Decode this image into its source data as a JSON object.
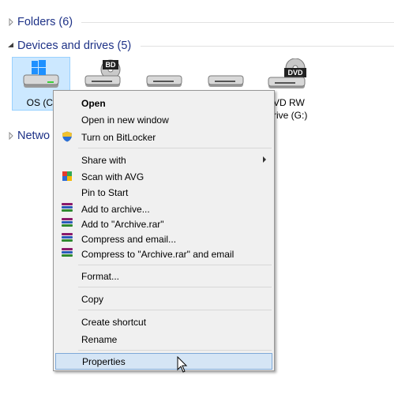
{
  "groups": {
    "folders": {
      "title": "Folders (6)"
    },
    "devices": {
      "title": "Devices and drives (5)"
    },
    "network": {
      "title": "Netwo"
    }
  },
  "drives": [
    {
      "label": "OS (C:",
      "icon": "windows-drive",
      "badge": ""
    },
    {
      "label": "",
      "icon": "bd-drive",
      "badge": "BD"
    },
    {
      "label": "",
      "icon": "hard-drive",
      "badge": ""
    },
    {
      "label": "",
      "icon": "hard-drive",
      "badge": ""
    },
    {
      "label": "VD RW",
      "label2": "rive (G:)",
      "icon": "dvd-drive",
      "badge": "DVD"
    }
  ],
  "menu": {
    "open": "Open",
    "open_new_window": "Open in new window",
    "bitlocker": "Turn on BitLocker",
    "share_with": "Share with",
    "scan_avg": "Scan with AVG",
    "pin_start": "Pin to Start",
    "add_archive": "Add to archive...",
    "add_archive_rar": "Add to \"Archive.rar\"",
    "compress_email": "Compress and email...",
    "compress_rar_email": "Compress to \"Archive.rar\" and email",
    "format": "Format...",
    "copy": "Copy",
    "create_shortcut": "Create shortcut",
    "rename": "Rename",
    "properties": "Properties"
  },
  "colors": {
    "group_title": "#1e3287",
    "selection": "#cce8ff",
    "menu_bg": "#f0f0f0",
    "menu_hover": "#d5e5f5"
  }
}
